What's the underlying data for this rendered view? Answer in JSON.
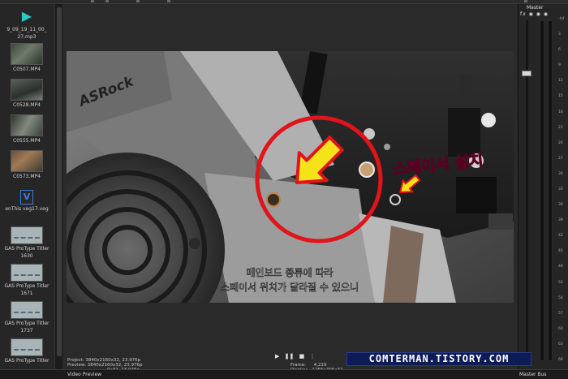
{
  "colors": {
    "accent_red": "#e0141a",
    "arrow_yellow": "#f5e31a",
    "handwriting_pink": "#ff5a8c",
    "watermark_bg": "#0e1b59"
  },
  "media": {
    "items": [
      {
        "kind": "audio",
        "icon": "audio-file-icon",
        "label": "9_09_19_11_00_",
        "label2": "27.mp3"
      },
      {
        "kind": "video",
        "icon": "video-thumbnail",
        "label": "C0507.MP4"
      },
      {
        "kind": "video",
        "icon": "video-thumbnail",
        "label": "C0528.MP4"
      },
      {
        "kind": "video",
        "icon": "video-thumbnail",
        "label": "C0555.MP4"
      },
      {
        "kind": "video",
        "icon": "video-thumbnail",
        "label": "C0573.MP4"
      },
      {
        "kind": "project",
        "icon": "vegas-project-icon",
        "label": "enThis veg17.veg"
      },
      {
        "kind": "titler",
        "icon": "titler-thumbnail",
        "label": "GAS ProType Titler",
        "label2": "1630"
      },
      {
        "kind": "titler",
        "icon": "titler-thumbnail",
        "label": "GAS ProType Titler",
        "label2": "1671"
      },
      {
        "kind": "titler",
        "icon": "titler-thumbnail",
        "label": "GAS ProType Titler",
        "label2": "1737"
      },
      {
        "kind": "titler",
        "icon": "titler-thumbnail",
        "label": "GAS ProType Titler",
        "label2": ""
      }
    ]
  },
  "preview": {
    "brand_text": "ASRock",
    "annotation_text": "스페이서 설치",
    "subtitle_line1": "메인보드 종류에 따라",
    "subtitle_line2": "스페이서 위치가 달라질 수 있으니",
    "info": {
      "project_label": "Project:",
      "project_value": "3840x2160x32, 23.976p",
      "preview_label": "Preview:",
      "preview_value": "3840x2160x32, 23.976p",
      "display_label": "Display:",
      "display_value": "1255x706x32",
      "frame_label": "Frame:",
      "frame_value": "4,219",
      "extra_value": "0x32, 23.976p"
    },
    "transport": {
      "play": "▶",
      "pause": "❚❚",
      "stop": "■",
      "more": "⋮"
    }
  },
  "master": {
    "title": "Master",
    "fx": "fx ◉ ◉ ◉",
    "scale": [
      "-Inf",
      "3",
      "6",
      "9",
      "12",
      "15",
      "18",
      "21",
      "24",
      "27",
      "30",
      "33",
      "36",
      "39",
      "42",
      "45",
      "48",
      "51",
      "54",
      "57",
      "60",
      "63",
      "66"
    ],
    "level_left": 0.0,
    "level_right": 0.0
  },
  "bottom": {
    "video_preview_tab": "Video Preview",
    "master_bus_tab": "Master Bus"
  },
  "watermark": {
    "text": "COMTERMAN.TISTORY.COM"
  }
}
